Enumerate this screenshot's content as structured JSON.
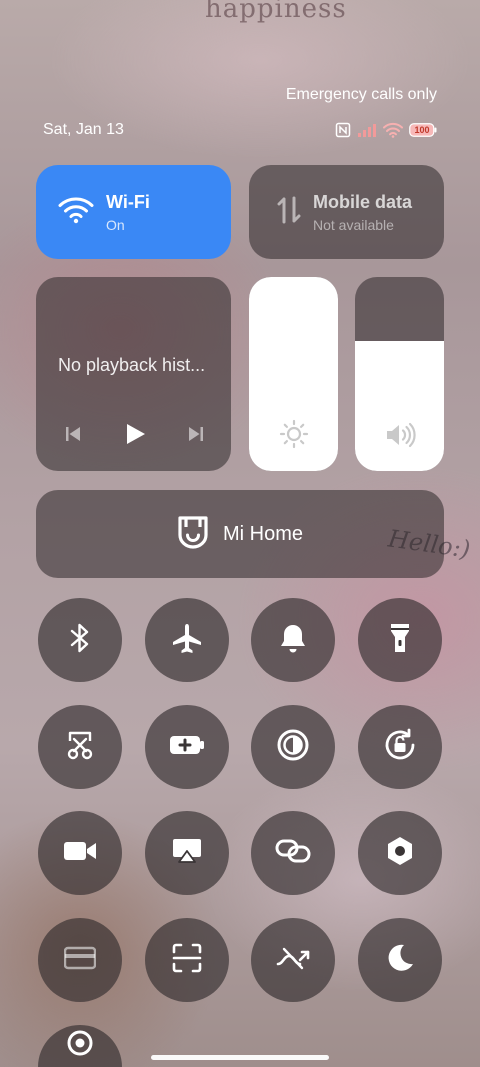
{
  "background": {
    "text_happiness": "happiness",
    "text_hello": "Hello:)"
  },
  "status": {
    "carrier_text": "Emergency calls only",
    "date": "Sat, Jan 13",
    "battery": "100"
  },
  "tiles": {
    "wifi": {
      "title": "Wi-Fi",
      "subtitle": "On",
      "icon": "wifi-icon",
      "color": "#3a88f5"
    },
    "mobile_data": {
      "title": "Mobile data",
      "subtitle": "Not available",
      "icon": "mobile-data-icon"
    }
  },
  "media": {
    "title": "No playback hist...",
    "controls": [
      "previous-icon",
      "play-icon",
      "next-icon"
    ]
  },
  "sliders": {
    "brightness": {
      "level": 1.0,
      "icon": "sun-icon"
    },
    "volume": {
      "level": 0.67,
      "icon": "speaker-icon"
    }
  },
  "mi_home": {
    "label": "Mi Home",
    "icon": "mi-home-icon"
  },
  "toggles": [
    "bluetooth-icon",
    "airplane-icon",
    "bell-icon",
    "flashlight-icon",
    "screenshot-icon",
    "battery-saver-icon",
    "dark-mode-icon",
    "rotation-lock-icon",
    "video-icon",
    "cast-icon",
    "link-icon",
    "settings-hex-icon",
    "card-icon",
    "scan-icon",
    "data-saver-icon",
    "moon-icon",
    "location-icon"
  ]
}
